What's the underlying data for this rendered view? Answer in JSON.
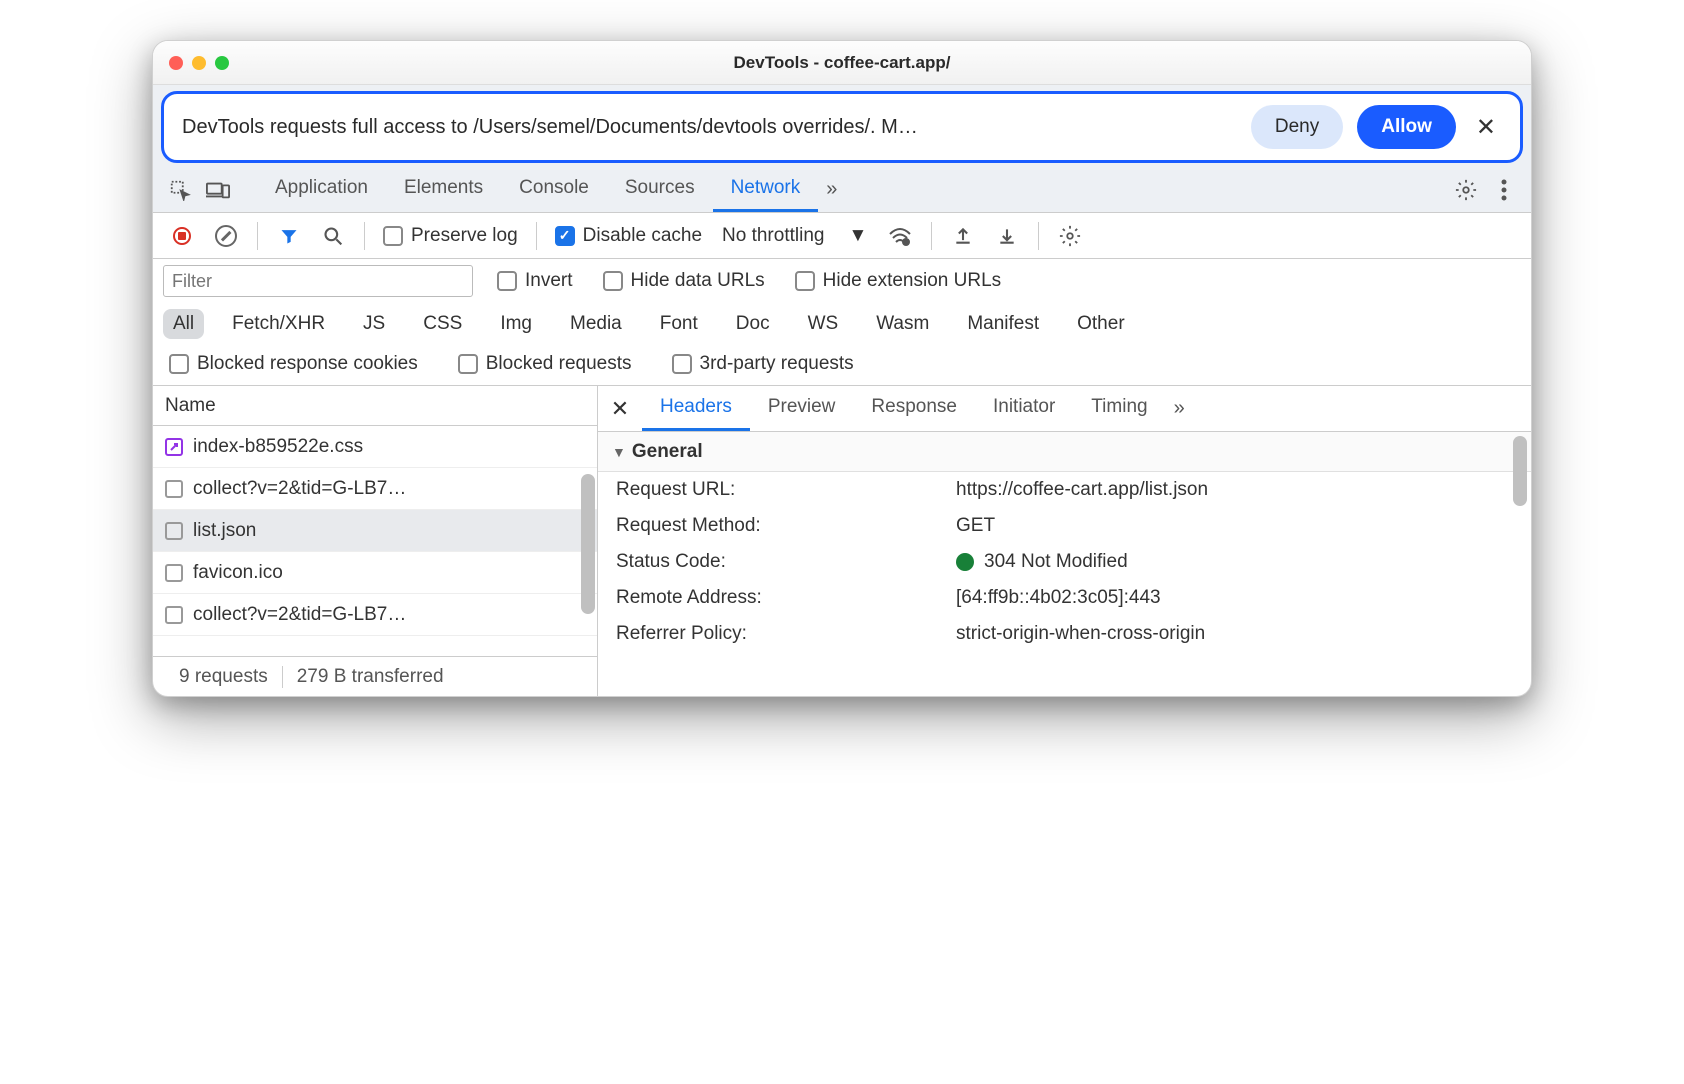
{
  "window": {
    "title": "DevTools - coffee-cart.app/"
  },
  "infobar": {
    "text": "DevTools requests full access to /Users/semel/Documents/devtools overrides/. M…",
    "deny": "Deny",
    "allow": "Allow"
  },
  "panels": {
    "application": "Application",
    "elements": "Elements",
    "console": "Console",
    "sources": "Sources",
    "network": "Network"
  },
  "toolbar": {
    "preserve_log": "Preserve log",
    "disable_cache": "Disable cache",
    "throttling": "No throttling"
  },
  "filter": {
    "placeholder": "Filter",
    "invert": "Invert",
    "hide_data": "Hide data URLs",
    "hide_ext": "Hide extension URLs"
  },
  "types": {
    "all": "All",
    "fetch": "Fetch/XHR",
    "js": "JS",
    "css": "CSS",
    "img": "Img",
    "media": "Media",
    "font": "Font",
    "doc": "Doc",
    "ws": "WS",
    "wasm": "Wasm",
    "manifest": "Manifest",
    "other": "Other"
  },
  "options": {
    "blocked_cookies": "Blocked response cookies",
    "blocked_requests": "Blocked requests",
    "third_party": "3rd-party requests"
  },
  "sidebar": {
    "header": "Name",
    "items": [
      {
        "name": "index-b859522e.css",
        "purple": true
      },
      {
        "name": "collect?v=2&tid=G-LB7…",
        "purple": false
      },
      {
        "name": "list.json",
        "purple": false,
        "selected": true
      },
      {
        "name": "favicon.ico",
        "purple": false
      },
      {
        "name": "collect?v=2&tid=G-LB7…",
        "purple": false
      }
    ]
  },
  "status": {
    "requests": "9 requests",
    "transferred": "279 B transferred"
  },
  "detail": {
    "tabs": {
      "headers": "Headers",
      "preview": "Preview",
      "response": "Response",
      "initiator": "Initiator",
      "timing": "Timing"
    },
    "section": "General",
    "rows": {
      "url_k": "Request URL:",
      "url_v": "https://coffee-cart.app/list.json",
      "method_k": "Request Method:",
      "method_v": "GET",
      "status_k": "Status Code:",
      "status_v": "304 Not Modified",
      "remote_k": "Remote Address:",
      "remote_v": "[64:ff9b::4b02:3c05]:443",
      "ref_k": "Referrer Policy:",
      "ref_v": "strict-origin-when-cross-origin"
    }
  }
}
